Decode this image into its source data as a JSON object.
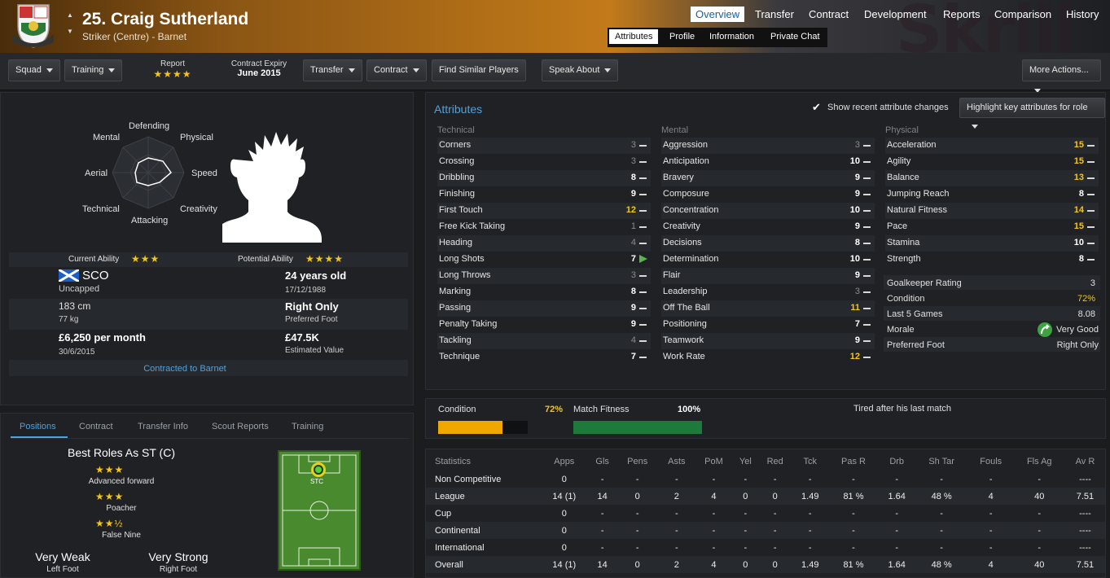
{
  "header": {
    "player_name": "25. Craig Sutherland",
    "player_position": "Striker (Centre) - Barnet",
    "tabs": [
      "Overview",
      "Transfer",
      "Contract",
      "Development",
      "Reports",
      "Comparison",
      "History"
    ],
    "subtabs": [
      "Attributes",
      "Profile",
      "Information",
      "Private Chat"
    ],
    "sponsor_text": "Skrill"
  },
  "toolbar": {
    "squad": "Squad",
    "training": "Training",
    "report_label": "Report",
    "report_stars": "★★★★",
    "contract_label": "Contract Expiry",
    "contract_value": "June 2015",
    "transfer": "Transfer",
    "contract": "Contract",
    "find_similar": "Find Similar Players",
    "speak_about": "Speak About",
    "more_actions": "More Actions..."
  },
  "profile": {
    "radar_labels": {
      "defending": "Defending",
      "physical": "Physical",
      "speed": "Speed",
      "creativity": "Creativity",
      "attacking": "Attacking",
      "technical": "Technical",
      "aerial": "Aerial",
      "mental": "Mental"
    },
    "current_ability_label": "Current Ability",
    "current_ability_stars": "★★★",
    "potential_ability_label": "Potential Ability",
    "potential_ability_stars": "★★★★",
    "nation": "SCO",
    "caps": "Uncapped",
    "age": "24 years old",
    "dob": "17/12/1988",
    "height": "183 cm",
    "weight": "77 kg",
    "foot": "Right Only",
    "foot_label": "Preferred Foot",
    "wage": "£6,250 per month",
    "contract_end": "30/6/2015",
    "value": "£47.5K",
    "value_label": "Estimated Value",
    "contracted_link": "Contracted to Barnet"
  },
  "positions": {
    "tabs": [
      "Positions",
      "Contract",
      "Transfer Info",
      "Scout Reports",
      "Training"
    ],
    "title": "Best Roles As ST (C)",
    "roles": [
      {
        "stars": "★★★",
        "name": "Advanced forward"
      },
      {
        "stars": "★★★",
        "name": "Poacher"
      },
      {
        "stars": "★★½",
        "name": "False Nine"
      }
    ],
    "left_foot_rating": "Very Weak",
    "left_foot_label": "Left Foot",
    "right_foot_rating": "Very Strong",
    "right_foot_label": "Right Foot",
    "pitch_marker": "STC"
  },
  "attributes": {
    "title": "Attributes",
    "show_changes": "Show recent attribute changes",
    "highlight_btn": "Highlight key attributes for role",
    "technical_label": "Technical",
    "mental_label": "Mental",
    "physical_label": "Physical",
    "technical": [
      {
        "name": "Corners",
        "value": "3",
        "trend": "flat"
      },
      {
        "name": "Crossing",
        "value": "3",
        "trend": "flat"
      },
      {
        "name": "Dribbling",
        "value": "8",
        "trend": "flat"
      },
      {
        "name": "Finishing",
        "value": "9",
        "trend": "flat"
      },
      {
        "name": "First Touch",
        "value": "12",
        "trend": "flat"
      },
      {
        "name": "Free Kick Taking",
        "value": "1",
        "trend": "flat"
      },
      {
        "name": "Heading",
        "value": "4",
        "trend": "flat"
      },
      {
        "name": "Long Shots",
        "value": "7",
        "trend": "up"
      },
      {
        "name": "Long Throws",
        "value": "3",
        "trend": "flat"
      },
      {
        "name": "Marking",
        "value": "8",
        "trend": "flat"
      },
      {
        "name": "Passing",
        "value": "9",
        "trend": "flat"
      },
      {
        "name": "Penalty Taking",
        "value": "9",
        "trend": "flat"
      },
      {
        "name": "Tackling",
        "value": "4",
        "trend": "flat"
      },
      {
        "name": "Technique",
        "value": "7",
        "trend": "flat"
      }
    ],
    "mental": [
      {
        "name": "Aggression",
        "value": "3",
        "trend": "flat"
      },
      {
        "name": "Anticipation",
        "value": "10",
        "trend": "flat"
      },
      {
        "name": "Bravery",
        "value": "9",
        "trend": "flat"
      },
      {
        "name": "Composure",
        "value": "9",
        "trend": "flat"
      },
      {
        "name": "Concentration",
        "value": "10",
        "trend": "flat"
      },
      {
        "name": "Creativity",
        "value": "9",
        "trend": "flat"
      },
      {
        "name": "Decisions",
        "value": "8",
        "trend": "flat"
      },
      {
        "name": "Determination",
        "value": "10",
        "trend": "flat"
      },
      {
        "name": "Flair",
        "value": "9",
        "trend": "flat"
      },
      {
        "name": "Leadership",
        "value": "3",
        "trend": "flat"
      },
      {
        "name": "Off The Ball",
        "value": "11",
        "trend": "flat"
      },
      {
        "name": "Positioning",
        "value": "7",
        "trend": "flat"
      },
      {
        "name": "Teamwork",
        "value": "9",
        "trend": "flat"
      },
      {
        "name": "Work Rate",
        "value": "12",
        "trend": "flat"
      }
    ],
    "physical": [
      {
        "name": "Acceleration",
        "value": "15",
        "trend": "flat"
      },
      {
        "name": "Agility",
        "value": "15",
        "trend": "flat"
      },
      {
        "name": "Balance",
        "value": "13",
        "trend": "flat"
      },
      {
        "name": "Jumping Reach",
        "value": "8",
        "trend": "flat"
      },
      {
        "name": "Natural Fitness",
        "value": "14",
        "trend": "flat"
      },
      {
        "name": "Pace",
        "value": "15",
        "trend": "flat"
      },
      {
        "name": "Stamina",
        "value": "10",
        "trend": "flat"
      },
      {
        "name": "Strength",
        "value": "8",
        "trend": "flat"
      }
    ],
    "extra": [
      {
        "name": "Goalkeeper Rating",
        "value": "3"
      },
      {
        "name": "Condition",
        "value": "72%"
      },
      {
        "name": "Last 5 Games",
        "value": "8.08"
      },
      {
        "name": "Morale",
        "value": "Very Good"
      },
      {
        "name": "Preferred Foot",
        "value": "Right Only"
      }
    ]
  },
  "fitness": {
    "condition_label": "Condition",
    "condition_value": "72%",
    "condition_fraction": 0.72,
    "match_fitness_label": "Match Fitness",
    "match_fitness_value": "100%",
    "match_fitness_fraction": 1.0,
    "note": "Tired after his last match",
    "colors": {
      "condition": "#f0a800",
      "match": "#1e7a3a"
    }
  },
  "statistics": {
    "headers": [
      "Statistics",
      "Apps",
      "Gls",
      "Pens",
      "Asts",
      "PoM",
      "Yel",
      "Red",
      "Tck",
      "Pas R",
      "Drb",
      "Sh Tar",
      "Fouls",
      "Fls Ag",
      "Av R"
    ],
    "rows": [
      [
        "Non Competitive",
        "0",
        "-",
        "-",
        "-",
        "-",
        "-",
        "-",
        "-",
        "-",
        "-",
        "-",
        "-",
        "-",
        "----"
      ],
      [
        "League",
        "14 (1)",
        "14",
        "0",
        "2",
        "4",
        "0",
        "0",
        "1.49",
        "81 %",
        "1.64",
        "48 %",
        "4",
        "40",
        "7.51"
      ],
      [
        "Cup",
        "0",
        "-",
        "-",
        "-",
        "-",
        "-",
        "-",
        "-",
        "-",
        "-",
        "-",
        "-",
        "-",
        "----"
      ],
      [
        "Continental",
        "0",
        "-",
        "-",
        "-",
        "-",
        "-",
        "-",
        "-",
        "-",
        "-",
        "-",
        "-",
        "-",
        "----"
      ],
      [
        "International",
        "0",
        "-",
        "-",
        "-",
        "-",
        "-",
        "-",
        "-",
        "-",
        "-",
        "-",
        "-",
        "-",
        "----"
      ],
      [
        "Overall",
        "14 (1)",
        "14",
        "0",
        "2",
        "4",
        "0",
        "0",
        "1.49",
        "81 %",
        "1.64",
        "48 %",
        "4",
        "40",
        "7.51"
      ]
    ]
  }
}
